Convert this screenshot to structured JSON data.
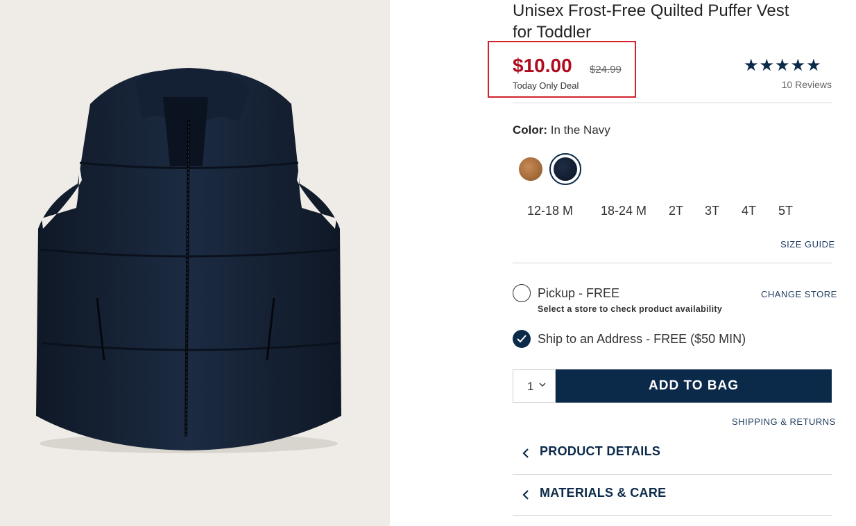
{
  "product": {
    "title_line1": "Unisex Frost-Free Quilted Puffer Vest",
    "title_line2": "for Toddler",
    "sale_price": "$10.00",
    "original_price": "$24.99",
    "deal_label": "Today Only Deal",
    "rating_stars": "★★★★★",
    "reviews": "10 Reviews"
  },
  "color": {
    "label": "Color:",
    "value": "In the Navy",
    "swatches": [
      "brown",
      "navy"
    ]
  },
  "sizes": [
    "12-18 M",
    "18-24 M",
    "2T",
    "3T",
    "4T",
    "5T"
  ],
  "size_guide": "SIZE GUIDE",
  "fulfillment": {
    "pickup_label": "Pickup - FREE",
    "pickup_sub": "Select a store to check product availability",
    "change_store": "CHANGE STORE",
    "ship_label": "Ship to an Address - FREE ($50 MIN)"
  },
  "cart": {
    "quantity": "1",
    "add_button": "ADD TO BAG",
    "shipping_link": "SHIPPING & RETURNS"
  },
  "accordions": [
    "PRODUCT DETAILS",
    "MATERIALS & CARE"
  ],
  "colors": {
    "sale": "#b00b1e",
    "brand": "#0b2a4a",
    "highlight_box": "#d0232a"
  }
}
